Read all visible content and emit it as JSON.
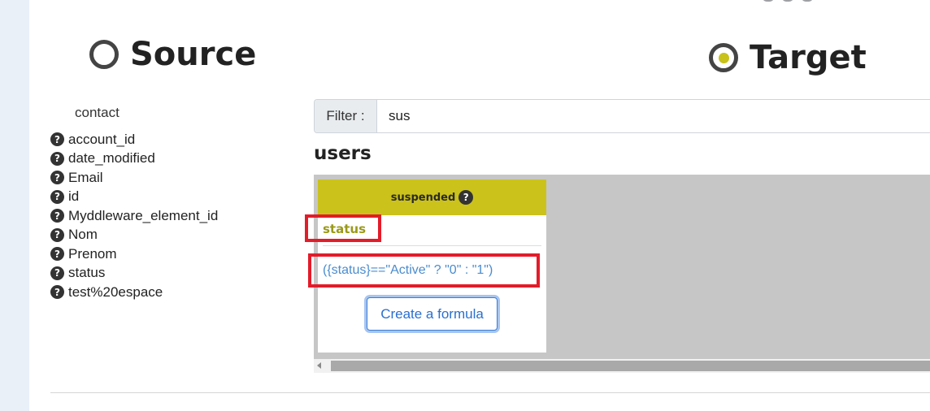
{
  "source": {
    "title": "Source",
    "object_name": "contact",
    "fields": [
      "account_id",
      "date_modified",
      "Email",
      "id",
      "Myddleware_element_id",
      "Nom",
      "Prenom",
      "status",
      "test%20espace"
    ]
  },
  "target": {
    "title": "Target",
    "filter_label": "Filter :",
    "filter_value": "sus",
    "module_name": "users",
    "card": {
      "target_field": "suspended",
      "source_field": "status",
      "formula": "({status}==\"Active\" ? \"0\" : \"1\")",
      "create_formula_label": "Create a formula"
    }
  },
  "icons": {
    "help": "?"
  },
  "colors": {
    "card_header": "#cbc21c",
    "radio_selected": "#c8c21a",
    "highlight": "#e31c2a",
    "formula_text": "#4a8ccf",
    "button_border": "#3b7dd8"
  }
}
